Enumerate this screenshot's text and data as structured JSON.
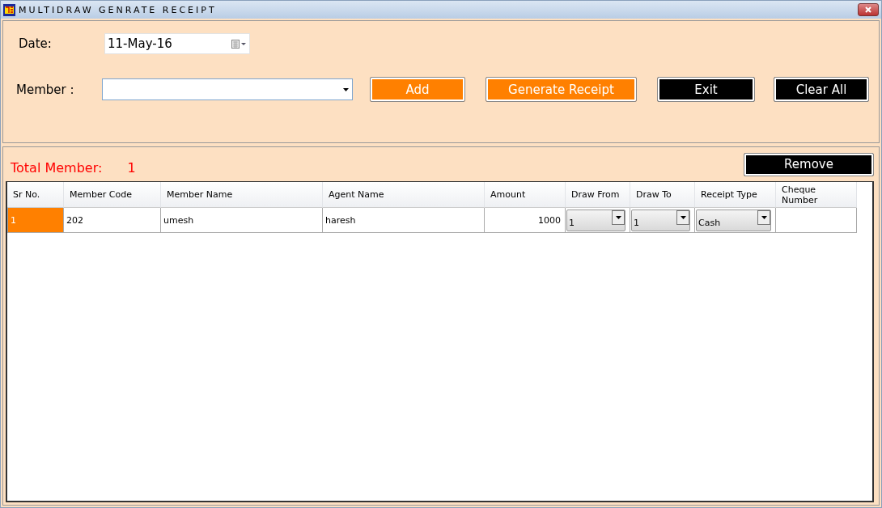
{
  "window": {
    "title": "MULTIDRAW GENRATE RECEIPT"
  },
  "date": {
    "label": "Date:",
    "value": "11-May-16"
  },
  "member": {
    "label": "Member :"
  },
  "buttons": [
    {
      "label": "Add",
      "kind": "primary"
    },
    {
      "label": "Generate Receipt",
      "kind": "primary"
    },
    {
      "label": "Exit",
      "kind": "dark"
    },
    {
      "label": "Clear All",
      "kind": "dark"
    }
  ],
  "total": {
    "label": "Total Member:",
    "value": "1"
  },
  "remove_button": {
    "label": "Remove"
  },
  "table": {
    "columns": [
      "Sr No.",
      "Member Code",
      "Member Name",
      "Agent Name",
      "Amount",
      "Draw From",
      "Draw To",
      "Receipt Type",
      "Cheque Number"
    ],
    "rows": [
      {
        "selected": true,
        "sr_no": "1",
        "member_code": "202",
        "member_name": "umesh",
        "agent_name": "haresh",
        "amount": "1000",
        "draw_from": "1",
        "draw_to": "1",
        "receipt_type": "Cash"
      }
    ]
  }
}
